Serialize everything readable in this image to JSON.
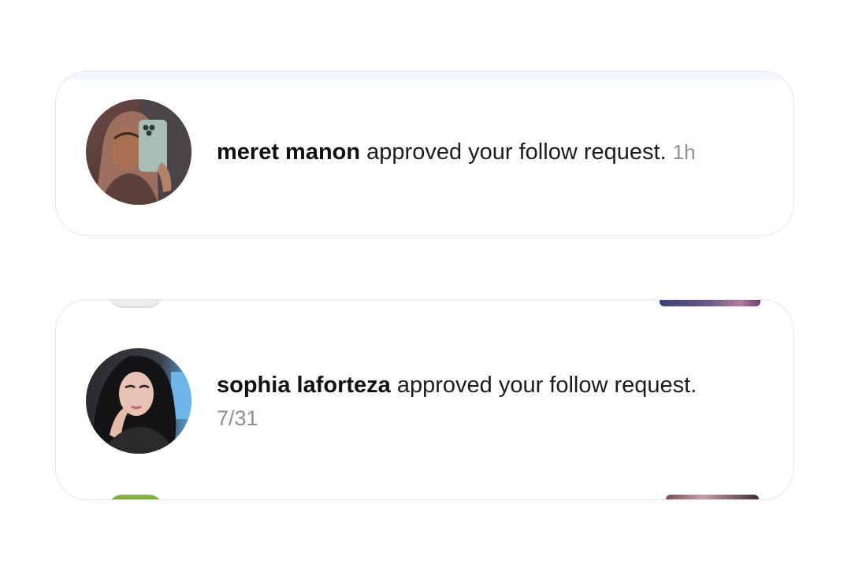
{
  "notifications": [
    {
      "username": "meret manon",
      "message": " approved your follow request.",
      "time": "1h",
      "avatar_icon": "profile-photo"
    },
    {
      "username": "sophia laforteza",
      "message": " approved your follow request.",
      "time": "7/31",
      "avatar_icon": "profile-photo"
    }
  ],
  "colors": {
    "background": "#ffffff",
    "card_border": "#e4e4e6",
    "text_primary": "#1c1c1e",
    "text_secondary": "#8e8e93"
  }
}
